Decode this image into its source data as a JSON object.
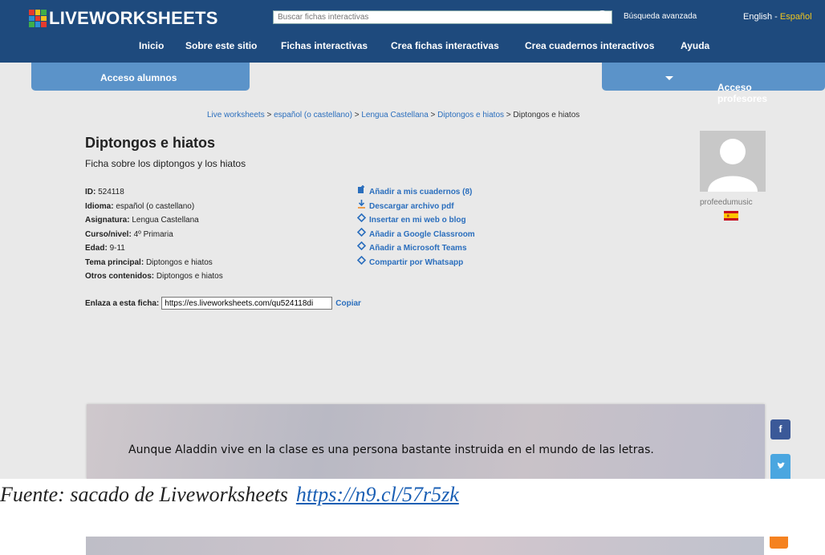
{
  "header": {
    "logo_text": "LIVEWORKSHEETS",
    "search_placeholder": "Buscar fichas interactivas",
    "advanced_search": "Búsqueda avanzada",
    "lang_english": "English",
    "lang_sep": " - ",
    "lang_spanish": "Español"
  },
  "nav": [
    "Inicio",
    "Sobre este sitio",
    "Fichas interactivas",
    "Crea fichas interactivas",
    "Crea cuadernos interactivos",
    "Ayuda"
  ],
  "access": {
    "students": "Acceso alumnos",
    "teachers": "Acceso profesores"
  },
  "breadcrumb": {
    "items": [
      "Live worksheets",
      "español (o castellano)",
      "Lengua Castellana",
      "Diptongos e hiatos"
    ],
    "current": "Diptongos e hiatos",
    "separator": " > "
  },
  "worksheet": {
    "title": "Diptongos e hiatos",
    "subtitle": "Ficha sobre los diptongos y los hiatos",
    "meta": [
      {
        "label": "ID:",
        "value": "524118"
      },
      {
        "label": "Idioma:",
        "value": "español (o castellano)"
      },
      {
        "label": "Asignatura:",
        "value": "Lengua Castellana"
      },
      {
        "label": "Curso/nivel:",
        "value": "4º Primaria"
      },
      {
        "label": "Edad:",
        "value": "9-11"
      },
      {
        "label": "Tema principal:",
        "value": "Diptongos e hiatos"
      },
      {
        "label": "Otros contenidos:",
        "value": "Diptongos e hiatos"
      }
    ],
    "actions": [
      {
        "label": "Añadir a mis cuadernos (8)",
        "icon": "add-notebook-icon"
      },
      {
        "label": "Descargar archivo pdf",
        "icon": "download-icon"
      },
      {
        "label": "Insertar en mi web o blog",
        "icon": "embed-icon"
      },
      {
        "label": "Añadir a Google Classroom",
        "icon": "embed-icon"
      },
      {
        "label": "Añadir a Microsoft Teams",
        "icon": "embed-icon"
      },
      {
        "label": "Compartir por Whatsapp",
        "icon": "embed-icon"
      }
    ],
    "link_label": "Enlaza a esta ficha:",
    "link_value": "https://es.liveworksheets.com/qu524118di",
    "copy_label": "Copiar",
    "author": "profeedumusic",
    "content_text": "Aunque Aladdin vive en la clase es una persona bastante instruida en el mundo de las letras."
  },
  "social": {
    "facebook": "f"
  },
  "caption": {
    "text": "Fuente: sacado de Liveworksheets",
    "link": "https://n9.cl/57r5zk"
  },
  "colors": {
    "header_bg": "#1e4a7d",
    "access_bg": "#5b93c9",
    "link": "#2a6ebd",
    "lang_active": "#f2c71d"
  }
}
